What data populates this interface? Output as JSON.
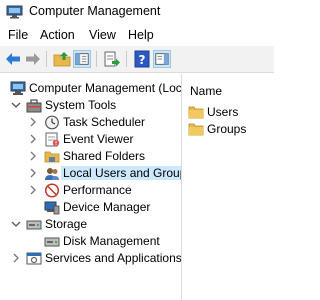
{
  "window": {
    "title": "Computer Management"
  },
  "menu": {
    "items": [
      "File",
      "Action",
      "View",
      "Help"
    ]
  },
  "toolbar": {
    "buttons": [
      "back-icon",
      "forward-icon",
      "up-folder-icon",
      "show-hide-tree-icon",
      "export-list-icon",
      "help-icon",
      "action-pane-icon"
    ]
  },
  "tree": {
    "root": "Computer Management (Local",
    "system_tools": "System Tools",
    "task_scheduler": "Task Scheduler",
    "event_viewer": "Event Viewer",
    "shared_folders": "Shared Folders",
    "local_users": "Local Users and Groups",
    "performance": "Performance",
    "device_manager": "Device Manager",
    "storage": "Storage",
    "disk_management": "Disk Management",
    "services": "Services and Applications",
    "selected": "Local Users and Groups"
  },
  "content": {
    "column_name": "Name",
    "items": [
      "Users",
      "Groups"
    ]
  },
  "colors": {
    "selection": "#cce8ff",
    "toolbar_bg": "#f2f2f2",
    "folder": "#e8b84a"
  }
}
